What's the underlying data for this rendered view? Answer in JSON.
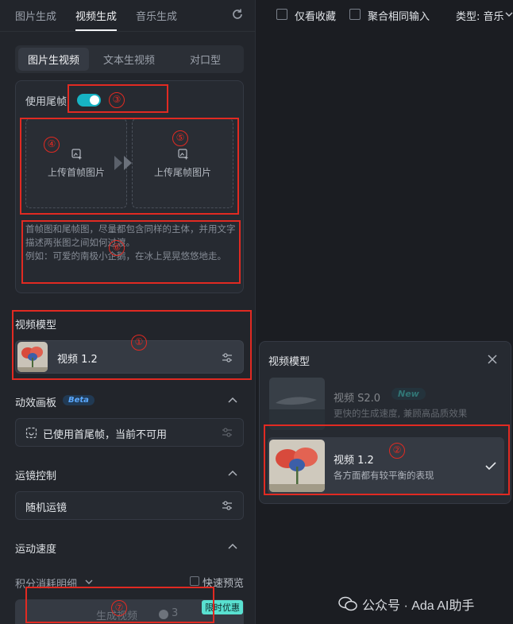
{
  "top_tabs": {
    "image_gen": "图片生成",
    "video_gen": "视频生成",
    "audio_gen": "音乐生成"
  },
  "sub_tabs": {
    "img2video": "图片生视频",
    "text2video": "文本生视频",
    "lipsync": "对口型"
  },
  "frame_settings": {
    "use_end_frame_label": "使用尾帧",
    "upload_first": "上传首帧图片",
    "upload_last": "上传尾帧图片",
    "hint_line1": "首帧图和尾帧图，尽量都包含同样的主体，并用文字描述两张图之间如何过渡。",
    "hint_line2": "例如：可爱的南极小企鹅，在冰上晃晃悠悠地走。"
  },
  "video_model": {
    "title": "视频模型",
    "selected": "视频 1.2"
  },
  "motion_canvas": {
    "title": "动效画板",
    "badge": "Beta",
    "status": "已使用首尾帧，当前不可用"
  },
  "camera": {
    "title": "运镜控制",
    "value": "随机运镜"
  },
  "speed": {
    "title": "运动速度"
  },
  "footer": {
    "points_label": "积分消耗明细",
    "quick_preview": "快速预览",
    "generate": "生成视频",
    "cost": "3",
    "promo": "限时优惠"
  },
  "filter_bar": {
    "favorites_only": "仅看收藏",
    "merge_same_input": "聚合相同输入",
    "type_label": "类型: 音乐"
  },
  "model_dropdown": {
    "title": "视频模型",
    "items": [
      {
        "name": "视频 S2.0",
        "badge": "New",
        "desc": "更快的生成速度, 兼顾高品质效果"
      },
      {
        "name": "视频 1.2",
        "desc": "各方面都有较平衡的表现"
      }
    ]
  },
  "annotations": [
    "①",
    "②",
    "③",
    "④",
    "⑤",
    "⑥",
    "⑦"
  ],
  "watermark": "公众号 · Ada AI助手",
  "colors": {
    "accent_toggle": "#17b3c4",
    "annotation_red": "#e12a22",
    "panel_bg": "#22252b",
    "page_bg": "#1b1d22"
  }
}
